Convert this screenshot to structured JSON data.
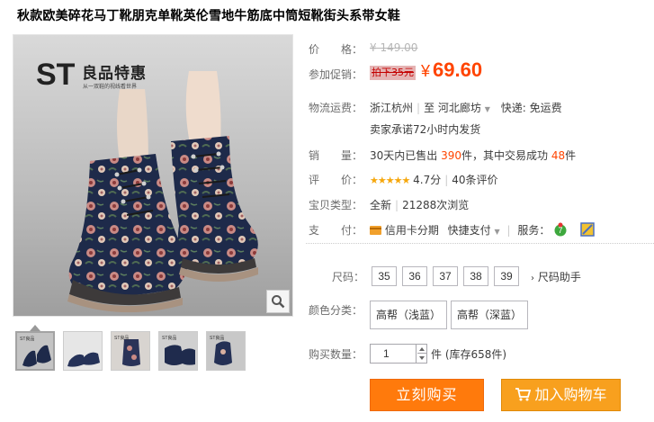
{
  "title": "秋款欧美碎花马丁靴朋克单靴英伦雪地牛筋底中筒短靴街头系带女鞋",
  "image": {
    "logo_main": "ST",
    "logo_cn": "良品特惠",
    "logo_sub": "从一双鞋的视线看世界",
    "thumb_label": "ST良品"
  },
  "price": {
    "label": "价　　格：",
    "value": "¥ 149.00"
  },
  "promo": {
    "label": "参加促销：",
    "tag": "拍下35元",
    "currency": "¥",
    "value": "69.60"
  },
  "shipping": {
    "label": "物流运费：",
    "from": "浙江杭州",
    "to_prefix": "至",
    "to": "河北廊坊",
    "fee": "快递: 免运费",
    "promise": "卖家承诺72小时内发货"
  },
  "sales": {
    "label": "销　　量：",
    "prefix": "30天内已售出",
    "count": "390",
    "mid": "件，其中交易成功",
    "success": "48",
    "suffix": "件"
  },
  "rating": {
    "label": "评　　价：",
    "stars": "★★★★★",
    "score": "4.7分",
    "reviews": "40条评价"
  },
  "item_type": {
    "label": "宝贝类型：",
    "condition": "全新",
    "views": "21288次浏览"
  },
  "payment": {
    "label": "支　　付：",
    "credit": "信用卡分期",
    "quick": "快捷支付",
    "services_label": "服务："
  },
  "size": {
    "label": "尺码：",
    "options": [
      "35",
      "36",
      "37",
      "38",
      "39"
    ],
    "helper": "尺码助手"
  },
  "color": {
    "label": "颜色分类：",
    "options": [
      "高帮（浅蓝）",
      "高帮（深蓝）"
    ]
  },
  "quantity": {
    "label": "购买数量：",
    "value": "1",
    "unit": "件",
    "stock": "(库存658件)"
  },
  "actions": {
    "buy": "立刻购买",
    "cart": "加入购物车"
  },
  "colors": {
    "accent": "#ff4400",
    "buy": "#ff7a0c",
    "cart": "#f8a01e"
  }
}
